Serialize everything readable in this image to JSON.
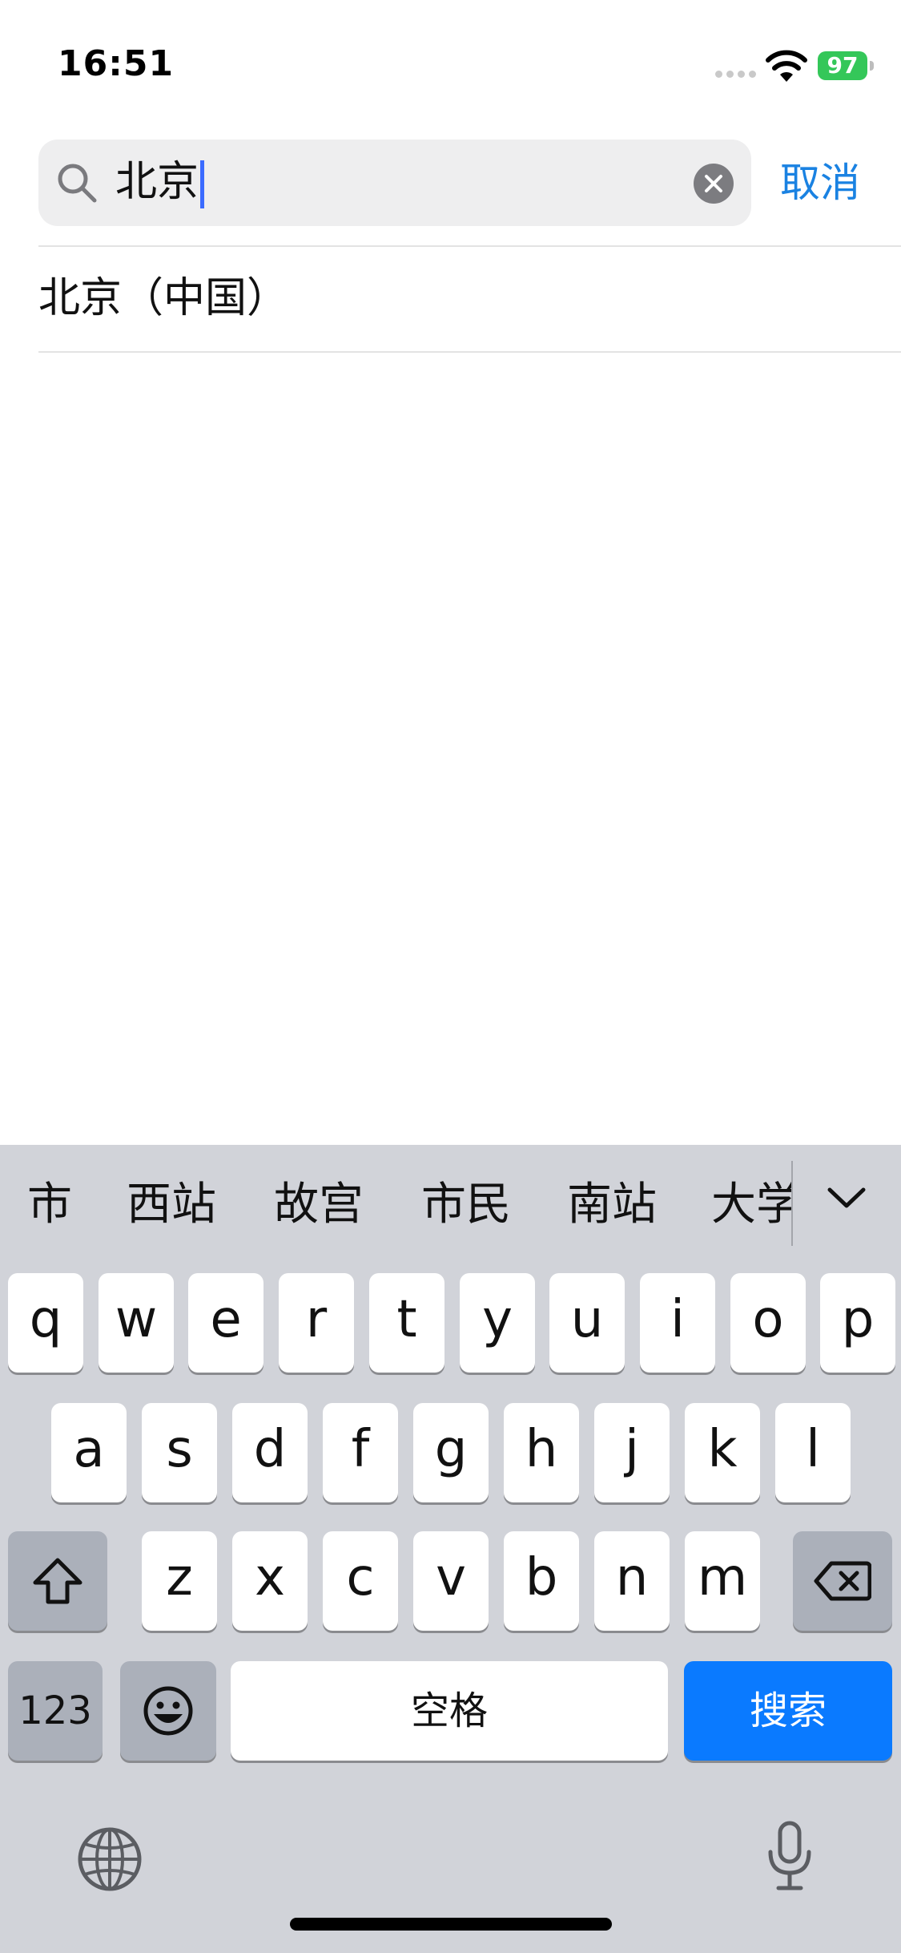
{
  "status_bar": {
    "time": "16:51",
    "battery": "97",
    "battery_color": "#34c759"
  },
  "search": {
    "query": "北京",
    "cancel_label": "取消",
    "accent_color": "#1a82e2"
  },
  "results": [
    {
      "label": "北京（中国）"
    }
  ],
  "keyboard": {
    "suggestions": [
      "市",
      "西站",
      "故宫",
      "市民",
      "南站",
      "大学"
    ],
    "rows": [
      [
        "q",
        "w",
        "e",
        "r",
        "t",
        "y",
        "u",
        "i",
        "o",
        "p"
      ],
      [
        "a",
        "s",
        "d",
        "f",
        "g",
        "h",
        "j",
        "k",
        "l"
      ],
      [
        "z",
        "x",
        "c",
        "v",
        "b",
        "n",
        "m"
      ]
    ],
    "numbers_label": "123",
    "space_label": "空格",
    "search_label": "搜索",
    "icons": {
      "shift": "shift-icon",
      "backspace": "backspace-icon",
      "emoji": "emoji-icon",
      "globe": "globe-icon",
      "mic": "microphone-icon",
      "collapse": "chevron-down-icon"
    }
  }
}
